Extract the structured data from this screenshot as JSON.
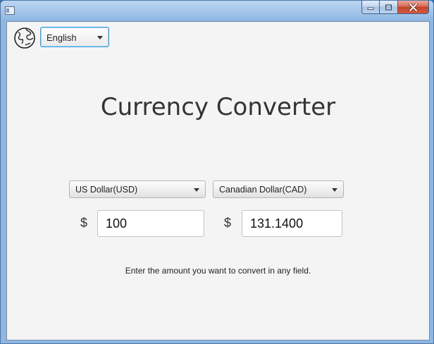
{
  "window": {
    "app_icon": "window-app-icon",
    "buttons": [
      "minimize-icon",
      "maximize-icon",
      "close-icon"
    ]
  },
  "language": {
    "icon": "globe-icon",
    "selected": "English"
  },
  "title": "Currency Converter",
  "converter": {
    "from_currency": "US Dollar(USD)",
    "to_currency": "Canadian Dollar(CAD)",
    "from_symbol": "$",
    "to_symbol": "$",
    "from_amount": "100",
    "to_amount": "131.1400"
  },
  "hint": "Enter the amount you want to convert in any field."
}
